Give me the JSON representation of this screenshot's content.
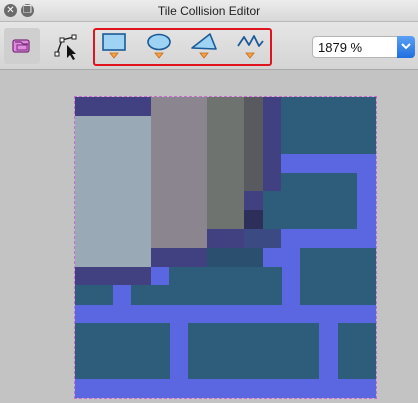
{
  "window": {
    "title": "Tile Collision Editor",
    "close_glyph": "✕",
    "float_glyph": "❐"
  },
  "toolbar": {
    "tools": [
      {
        "id": "select-tile",
        "icon": "tile-select-icon",
        "active": true
      },
      {
        "id": "edit-polygons",
        "icon": "edit-polygons-icon",
        "active": false
      },
      {
        "id": "rectangle",
        "icon": "rectangle-icon",
        "active": false
      },
      {
        "id": "ellipse",
        "icon": "ellipse-icon",
        "active": false
      },
      {
        "id": "polygon",
        "icon": "polygon-icon",
        "active": false
      },
      {
        "id": "polyline",
        "icon": "polyline-icon",
        "active": false
      }
    ],
    "highlight_color": "#e0141f"
  },
  "zoom": {
    "value": "1879 %"
  },
  "colors": {
    "canvas_bg": "#c3c3c3",
    "tile_blue": "#5b67e0",
    "tile_teal": "#2e5d7c",
    "selection_outline": "#c86ecf"
  }
}
